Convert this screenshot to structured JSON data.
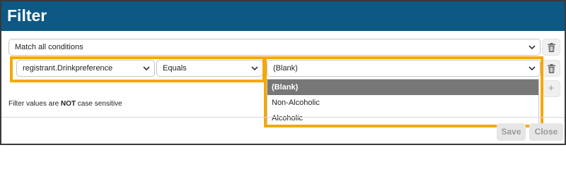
{
  "dialog": {
    "title": "Filter"
  },
  "match": {
    "value": "Match all conditions"
  },
  "condition": {
    "field": "registrant.Drinkpreference",
    "operator": "Equals",
    "value": "(Blank)"
  },
  "dropdown": {
    "options": [
      {
        "label": "(Blank)",
        "selected": true
      },
      {
        "label": "Non-Alcoholic",
        "selected": false
      },
      {
        "label": "Alcoholic",
        "selected": false
      }
    ]
  },
  "note": {
    "prefix": "Filter values are ",
    "emphasis": "NOT",
    "suffix": " case sensitive"
  },
  "footer": {
    "save_label": "Save",
    "close_label": "Close"
  },
  "icons": {
    "add": "+",
    "delete": "trash-icon",
    "chevron": "chevron-down-icon"
  },
  "colors": {
    "header": "#0d5885",
    "highlight": "#f5a800",
    "selected_option": "#777777"
  }
}
